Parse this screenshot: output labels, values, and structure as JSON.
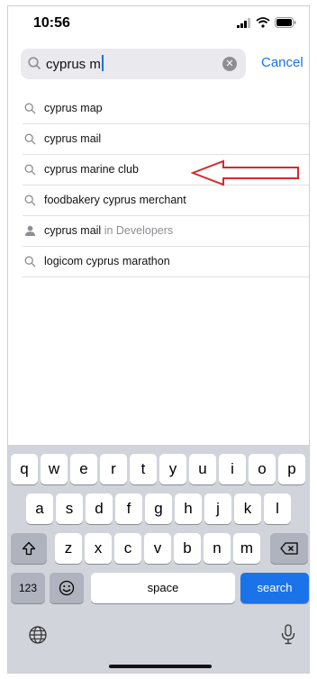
{
  "status_bar": {
    "time": "10:56"
  },
  "search": {
    "query": "cyprus m",
    "cancel_label": "Cancel"
  },
  "suggestions": [
    {
      "text": "cyprus map",
      "icon": "search-icon"
    },
    {
      "text": "cyprus mail",
      "icon": "search-icon"
    },
    {
      "text": "cyprus marine club",
      "icon": "search-icon"
    },
    {
      "text": "foodbakery cyprus merchant",
      "icon": "search-icon"
    },
    {
      "text": "cyprus mail",
      "suffix": "in Developers",
      "icon": "person-icon"
    },
    {
      "text": "logicom cyprus marathon",
      "icon": "search-icon"
    }
  ],
  "keyboard": {
    "row1": [
      "q",
      "w",
      "e",
      "r",
      "t",
      "y",
      "u",
      "i",
      "o",
      "p"
    ],
    "row2": [
      "a",
      "s",
      "d",
      "f",
      "g",
      "h",
      "j",
      "k",
      "l"
    ],
    "row3": [
      "z",
      "x",
      "c",
      "v",
      "b",
      "n",
      "m"
    ],
    "numbers_label": "123",
    "space_label": "space",
    "search_label": "search",
    "accent_color": "#1a73e8"
  }
}
